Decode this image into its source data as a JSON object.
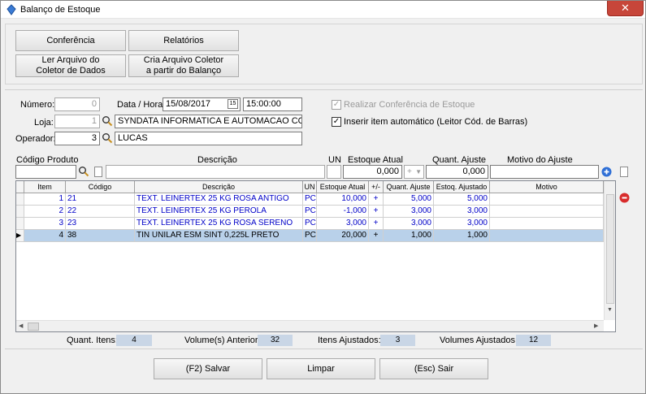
{
  "window": {
    "title": "Balanço de Estoque",
    "close": "✕"
  },
  "toolbar": {
    "conferencia": "Conferência",
    "relatorios": "Relatórios",
    "ler_arquivo_1": "Ler Arquivo do",
    "ler_arquivo_2": "Coletor de Dados",
    "cria_arquivo_1": "Cria Arquivo Coletor",
    "cria_arquivo_2": "a partir do Balanço"
  },
  "form": {
    "numero_label": "Número:",
    "numero_value": "0",
    "data_label": "Data / Hora:",
    "data_value": "15/08/2017",
    "hora_value": "15:00:00",
    "loja_label": "Loja:",
    "loja_code": "1",
    "loja_name": "SYNDATA INFORMATICA E AUTOMACAO COME",
    "operador_label": "Operador:",
    "operador_code": "3",
    "operador_name": "LUCAS",
    "realizar_conf": "Realizar Conferência de Estoque",
    "inserir_item": "Inserir item automático (Leitor Cód. de Barras)"
  },
  "entry": {
    "codigo_label": "Código Produto",
    "descricao_label": "Descrição",
    "un_label": "UN",
    "estoque_label": "Estoque Atual",
    "quant_label": "Quant. Ajuste",
    "motivo_label": "Motivo do Ajuste",
    "estoque_value": "0,000",
    "sign_value": "+",
    "quant_value": "0,000"
  },
  "grid": {
    "headers": [
      "Item",
      "Código",
      "Descrição",
      "UN",
      "Estoque Atual",
      "+/-",
      "Quant. Ajuste",
      "Estoq. Ajustado",
      "Motivo"
    ],
    "rows": [
      {
        "item": "1",
        "codigo": "21",
        "descricao": "TEXT. LEINERTEX 25 KG ROSA ANTIGO",
        "un": "PC",
        "estoque": "10,000",
        "sinal": "+",
        "quant": "5,000",
        "ajustado": "5,000",
        "motivo": ""
      },
      {
        "item": "2",
        "codigo": "22",
        "descricao": "TEXT. LEINERTEX 25 KG PEROLA",
        "un": "PC",
        "estoque": "-1,000",
        "sinal": "+",
        "quant": "3,000",
        "ajustado": "3,000",
        "motivo": ""
      },
      {
        "item": "3",
        "codigo": "23",
        "descricao": "TEXT. LEINERTEX 25 KG ROSA SERENO",
        "un": "PC",
        "estoque": "3,000",
        "sinal": "+",
        "quant": "3,000",
        "ajustado": "3,000",
        "motivo": ""
      },
      {
        "item": "4",
        "codigo": "38",
        "descricao": "TIN UNILAR ESM SINT 0,225L PRETO",
        "un": "PC",
        "estoque": "20,000",
        "sinal": "+",
        "quant": "1,000",
        "ajustado": "1,000",
        "motivo": ""
      }
    ]
  },
  "summary": {
    "quant_itens_label": "Quant. Itens:",
    "quant_itens": "4",
    "vol_anterior_label": "Volume(s) Anterior:",
    "vol_anterior": "32",
    "itens_ajust_label": "Itens Ajustados:",
    "itens_ajust": "3",
    "vol_ajust_label": "Volumes Ajustados:",
    "vol_ajust": "12"
  },
  "footer": {
    "salvar": "(F2) Salvar",
    "limpar": "Limpar",
    "sair": "(Esc) Sair"
  },
  "colors": {
    "accent": "#0000c8",
    "selection": "#b9d1ea",
    "close": "#c7463a"
  }
}
